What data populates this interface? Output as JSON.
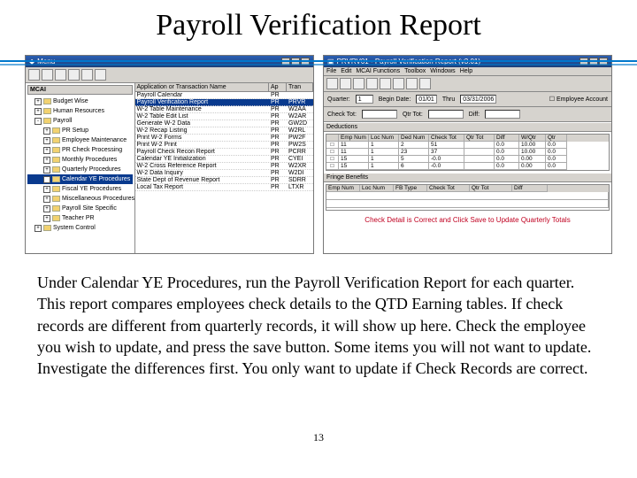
{
  "slide": {
    "title": "Payroll Verification Report",
    "body": "Under Calendar YE Procedures, run the Payroll Verification Report for each quarter.  This report compares employees check details to the QTD Earning tables. If check records are different from quarterly records, it will show up here.  Check the employee you wish to update, and press the save button.  Some items you will not want to update.  Investigate the differences first. You only want to update if Check Records are correct.",
    "page": "13"
  },
  "left_window": {
    "title": "Menu",
    "tree_header": "MCAI",
    "tree": [
      {
        "exp": "+",
        "label": "Budget Wise"
      },
      {
        "exp": "+",
        "label": "Human Resources"
      },
      {
        "exp": "-",
        "label": "Payroll"
      },
      {
        "exp": "+",
        "label": "PR Setup",
        "sub": true
      },
      {
        "exp": "+",
        "label": "Employee Maintenance",
        "sub": true
      },
      {
        "exp": "+",
        "label": "PR Check Processing",
        "sub": true
      },
      {
        "exp": "+",
        "label": "Monthly Procedures",
        "sub": true
      },
      {
        "exp": "+",
        "label": "Quarterly Procedures",
        "sub": true
      },
      {
        "exp": "+",
        "label": "Calendar YE Procedures",
        "sub": true,
        "sel": true
      },
      {
        "exp": "+",
        "label": "Fiscal YE Procedures",
        "sub": true
      },
      {
        "exp": "+",
        "label": "Miscellaneous Procedures",
        "sub": true
      },
      {
        "exp": "+",
        "label": "Payroll Site Specific",
        "sub": true
      },
      {
        "exp": "+",
        "label": "Teacher PR",
        "sub": true
      },
      {
        "exp": "+",
        "label": "System Control"
      }
    ],
    "list_header": {
      "c1": "Application or Transaction Name",
      "c2": "Ap",
      "c3": "Tran"
    },
    "list": [
      {
        "name": "Payroll Calendar",
        "ap": "PR",
        "tr": ""
      },
      {
        "name": "Payroll Verification Report",
        "ap": "PR",
        "tr": "PRVR",
        "sel": true
      },
      {
        "name": "W-2 Table Maintenance",
        "ap": "PR",
        "tr": "W2AA"
      },
      {
        "name": "W-2 Table Edit List",
        "ap": "PR",
        "tr": "W2AR"
      },
      {
        "name": "Generate W-2 Data",
        "ap": "PR",
        "tr": "GW2D"
      },
      {
        "name": "W-2 Recap Listing",
        "ap": "PR",
        "tr": "W2RL"
      },
      {
        "name": "Print W-2 Forms",
        "ap": "PR",
        "tr": "PW2F"
      },
      {
        "name": "Print W-2 Print",
        "ap": "PR",
        "tr": "PW2S"
      },
      {
        "name": "Payroll Check Recon Report",
        "ap": "PR",
        "tr": "PCRR"
      },
      {
        "name": "Calendar YE Initialization",
        "ap": "PR",
        "tr": "CYEI"
      },
      {
        "name": "W-2 Cross Reference Report",
        "ap": "PR",
        "tr": "W2XR"
      },
      {
        "name": "W-2 Data Inquiry",
        "ap": "PR",
        "tr": "W2DI"
      },
      {
        "name": "State Dept of Revenue Report",
        "ap": "PR",
        "tr": "SDRR"
      },
      {
        "name": "Local Tax Report",
        "ap": "PR",
        "tr": "LTXR"
      }
    ]
  },
  "right_window": {
    "title": "PRVRV01 - Payroll Verification Report (v3.01)",
    "menubar": [
      "File",
      "Edit",
      "MCAI Functions",
      "Toolbox",
      "Windows",
      "Help"
    ],
    "form": {
      "quarter_lbl": "Quarter:",
      "quarter_val": "1",
      "begin_lbl": "Begin Date:",
      "begin_val": "01/01",
      "end_lbl": "Thru",
      "end_val": "03/31/2006",
      "chktot_lbl": "Check Tot:",
      "emp_lbl": "Employee Account"
    },
    "deductions_lbl": "Deductions",
    "ded_header": [
      "",
      "Emp Num",
      "Loc Num",
      "Ded Num",
      "Check Tot",
      "Qtr Tot",
      "Diff",
      "W/Qtr",
      "Qtr"
    ],
    "ded_rows": [
      [
        "□",
        "11",
        "1",
        "2",
        "51",
        "",
        "0.0",
        "10.00",
        "0.0"
      ],
      [
        "□",
        "11",
        "1",
        "23",
        "37",
        "",
        "0.0",
        "10.00",
        "0.0"
      ],
      [
        "□",
        "15",
        "1",
        "5",
        "-0.0",
        "",
        "0.0",
        "0.00",
        "0.0"
      ],
      [
        "□",
        "15",
        "1",
        "6",
        "-0.0",
        "",
        "0.0",
        "0.00",
        "0.0"
      ]
    ],
    "fringe_lbl": "Fringe Benefits",
    "fringe_header": [
      "Emp Num",
      "Loc Num",
      "FB Type",
      "Check Tot",
      "Qtr Tot",
      "Diff"
    ],
    "message": "Check Detail is Correct and Click Save to Update Quarterly Totals"
  }
}
